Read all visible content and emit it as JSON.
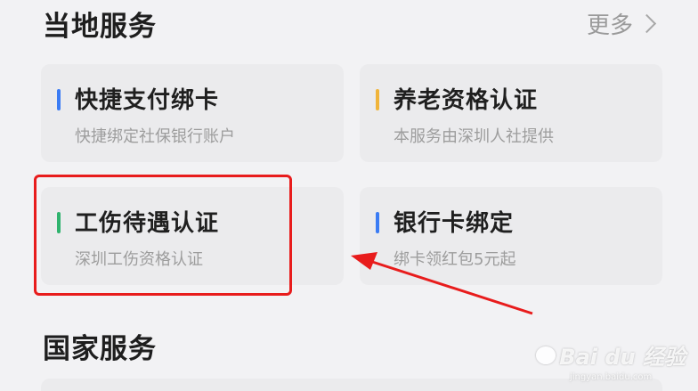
{
  "local_section": {
    "title": "当地服务",
    "more_label": "更多"
  },
  "cards": [
    {
      "title": "快捷支付绑卡",
      "subtitle": "快捷绑定社保银行账户",
      "accent": "#3b7cf4"
    },
    {
      "title": "养老资格认证",
      "subtitle": "本服务由深圳人社提供",
      "accent": "#f0b43a"
    },
    {
      "title": "工伤待遇认证",
      "subtitle": "深圳工伤资格认证",
      "accent": "#2fb36e"
    },
    {
      "title": "银行卡绑定",
      "subtitle": "绑卡领红包5元起",
      "accent": "#3b7cf4"
    }
  ],
  "national_section": {
    "title": "国家服务"
  },
  "annotation_color": "#e81c1c",
  "watermark": {
    "brand": "Bai du 经验",
    "url": "jingyan.baidu.com"
  }
}
